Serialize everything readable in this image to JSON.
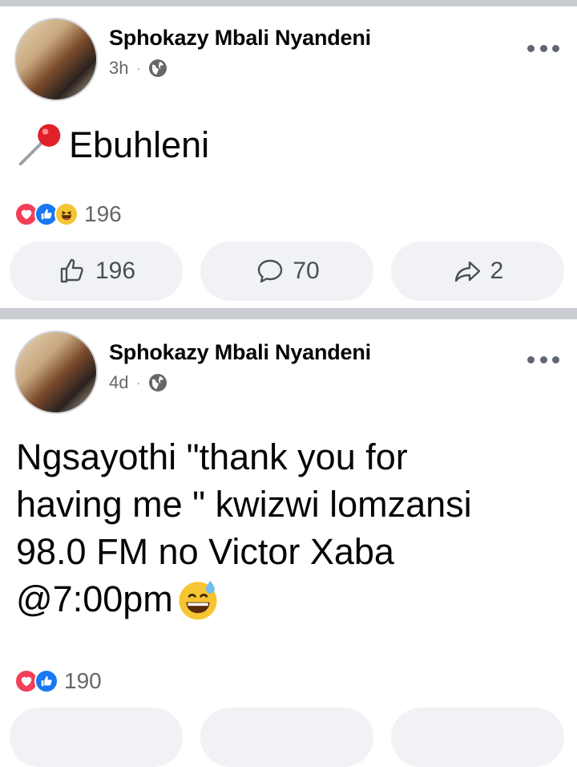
{
  "posts": [
    {
      "author": "Sphokazy Mbali Nyandeni",
      "time": "3h",
      "separator": "·",
      "text_emoji": "pushpin",
      "text": "Ebuhleni",
      "reactions": {
        "types": [
          "love",
          "like",
          "haha"
        ],
        "count": "196"
      },
      "actions": {
        "like": "196",
        "comment": "70",
        "share": "2"
      }
    },
    {
      "author": "Sphokazy Mbali Nyandeni",
      "time": "4d",
      "separator": "·",
      "text_lines": [
        "Ngsayothi \"thank you for",
        "having me \" kwizwi lomzansi",
        "98.0 FM no Victor Xaba",
        "@7:00pm"
      ],
      "text_emoji": "grinning-sweat",
      "reactions": {
        "types": [
          "love",
          "like"
        ],
        "count": "190"
      }
    }
  ],
  "colors": {
    "divider": "#c9ccd1",
    "meta": "#65676b",
    "button_bg": "#f0f2f5"
  }
}
